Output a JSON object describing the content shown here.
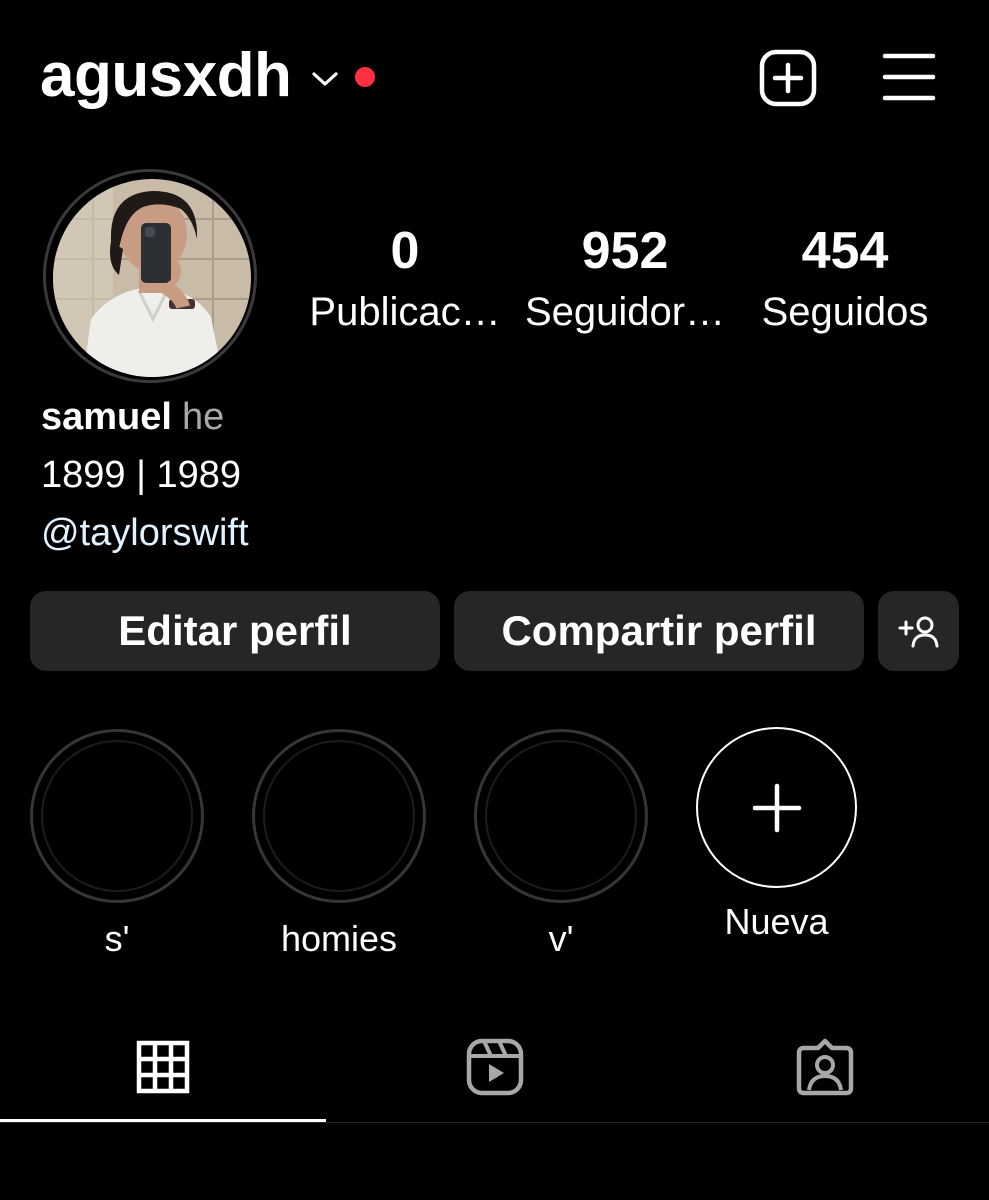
{
  "header": {
    "username": "agusxdh",
    "notification_dot_color": "#ff3040",
    "icons": [
      "chevron-down-icon",
      "new-post-icon",
      "menu-icon"
    ]
  },
  "profile": {
    "avatar_icon": "profile-photo",
    "stats": {
      "posts": {
        "value": "0",
        "label": "Publicac…"
      },
      "followers": {
        "value": "952",
        "label": "Seguidor…"
      },
      "following": {
        "value": "454",
        "label": "Seguidos"
      }
    }
  },
  "bio": {
    "name": "samuel",
    "pronouns": "he",
    "line1": "1899 | 1989",
    "link": "@taylorswift"
  },
  "actions": {
    "edit_label": "Editar perfil",
    "share_label": "Compartir perfil",
    "suggest_icon": "add-person-icon"
  },
  "highlights": [
    {
      "label": "s'"
    },
    {
      "label": "homies"
    },
    {
      "label": "v'"
    },
    {
      "label": "Nueva"
    }
  ],
  "tabs": {
    "active": "grid",
    "items": [
      "grid-icon",
      "reels-icon",
      "tagged-icon"
    ]
  }
}
